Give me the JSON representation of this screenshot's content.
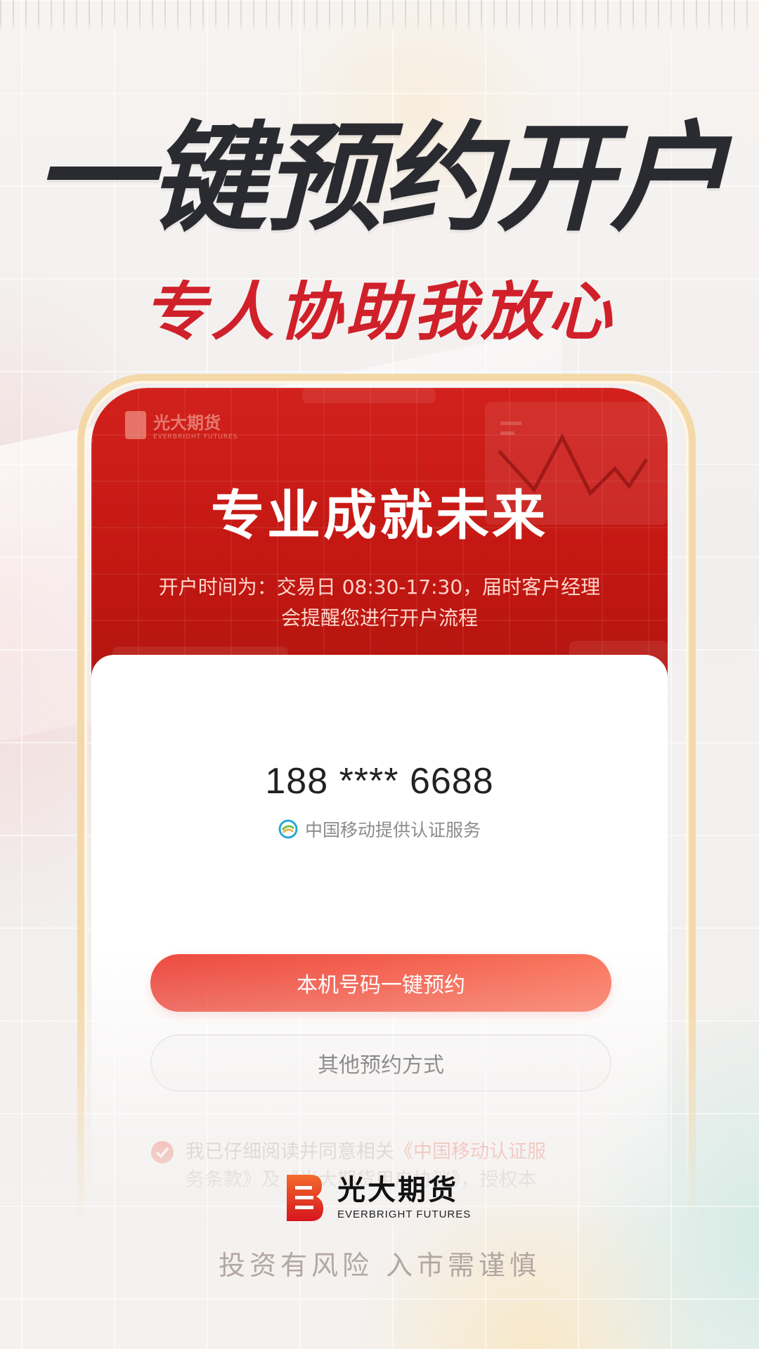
{
  "headline": "一键预约开户",
  "subheadline": "专人协助我放心",
  "hero": {
    "logo_cn": "光大期货",
    "logo_en": "EVERBRIGHT FUTURES",
    "title": "专业成就未来",
    "desc_line1": "开户时间为：交易日 08:30-17:30，届时客户经理",
    "desc_line2": "会提醒您进行开户流程"
  },
  "auth": {
    "phone_number": "188 **** 6688",
    "carrier_text": "中国移动提供认证服务",
    "carrier_icon": "china-mobile-icon"
  },
  "buttons": {
    "primary": "本机号码一键预约",
    "secondary": "其他预约方式"
  },
  "agreement": {
    "prefix": "我已仔细阅读并同意相关",
    "link": "《中国移动认证服",
    "line2": "务条款》及《光大期货用户协议》，授权本"
  },
  "brand": {
    "cn": "光大期货",
    "en": "EVERBRIGHT FUTURES"
  },
  "disclaimer": "投资有风险 入市需谨慎",
  "colors": {
    "brand_red": "#d0202a",
    "button_gradient_start": "#ec3e32",
    "button_gradient_end": "#fa6c52",
    "link": "#f0533c"
  }
}
